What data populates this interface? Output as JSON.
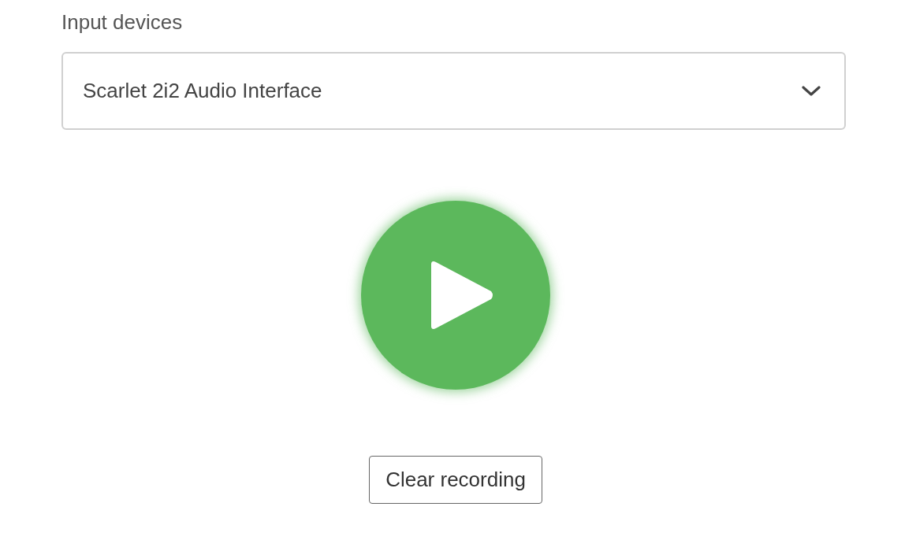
{
  "input_devices": {
    "label": "Input devices",
    "value": "Scarlet 2i2 Audio Interface"
  },
  "clear_button": {
    "label": "Clear recording"
  }
}
